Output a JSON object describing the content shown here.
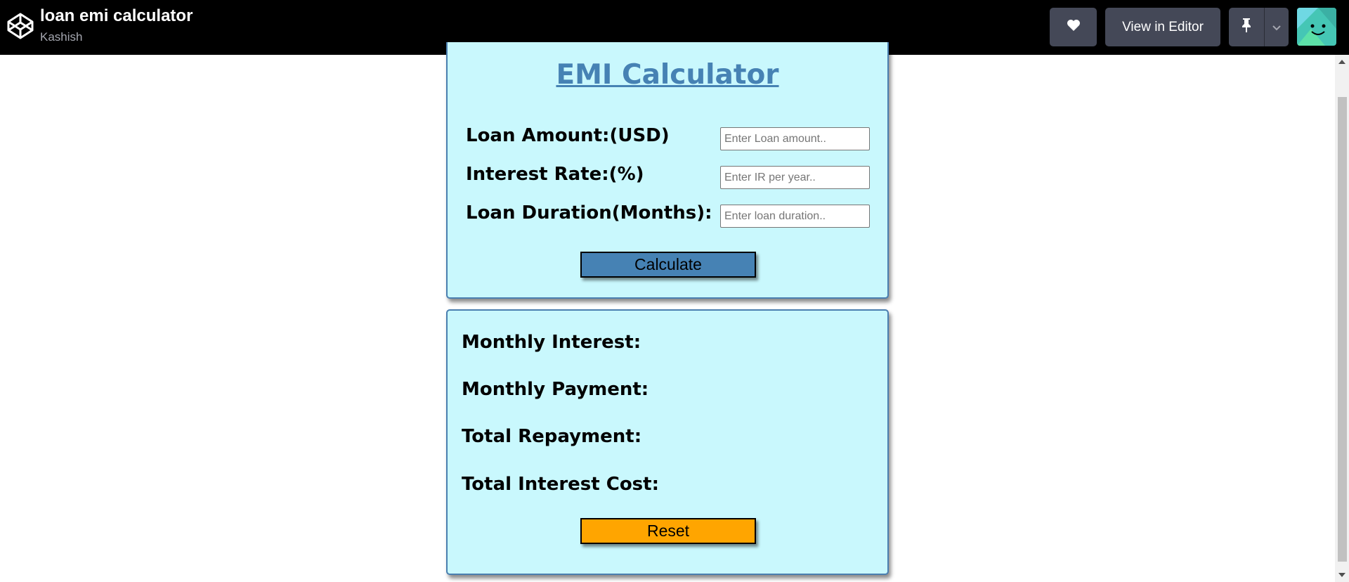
{
  "header": {
    "title": "loan emi calculator",
    "author": "Kashish",
    "logo_icon": "codepen-logo-icon",
    "heart_icon": "heart-icon",
    "editor_label": "View in Editor",
    "pin_icon": "pin-icon",
    "dropdown_icon": "chevron-down-icon"
  },
  "calculator": {
    "title": "EMI Calculator",
    "fields": [
      {
        "label": "Loan Amount:(USD)",
        "placeholder": "Enter Loan amount.."
      },
      {
        "label": "Interest Rate:(%)",
        "placeholder": "Enter IR per year.."
      },
      {
        "label": "Loan Duration(Months):",
        "placeholder": "Enter loan duration.."
      }
    ],
    "calculate_label": "Calculate"
  },
  "results": {
    "items": [
      {
        "label": "Monthly Interest:"
      },
      {
        "label": "Monthly Payment:"
      },
      {
        "label": "Total Repayment:"
      },
      {
        "label": "Total Interest Cost:"
      }
    ],
    "reset_label": "Reset"
  },
  "colors": {
    "accent": "#4682b4",
    "card_bg": "#c9f8fd",
    "reset": "#ffa500",
    "topbar": "#000000"
  }
}
